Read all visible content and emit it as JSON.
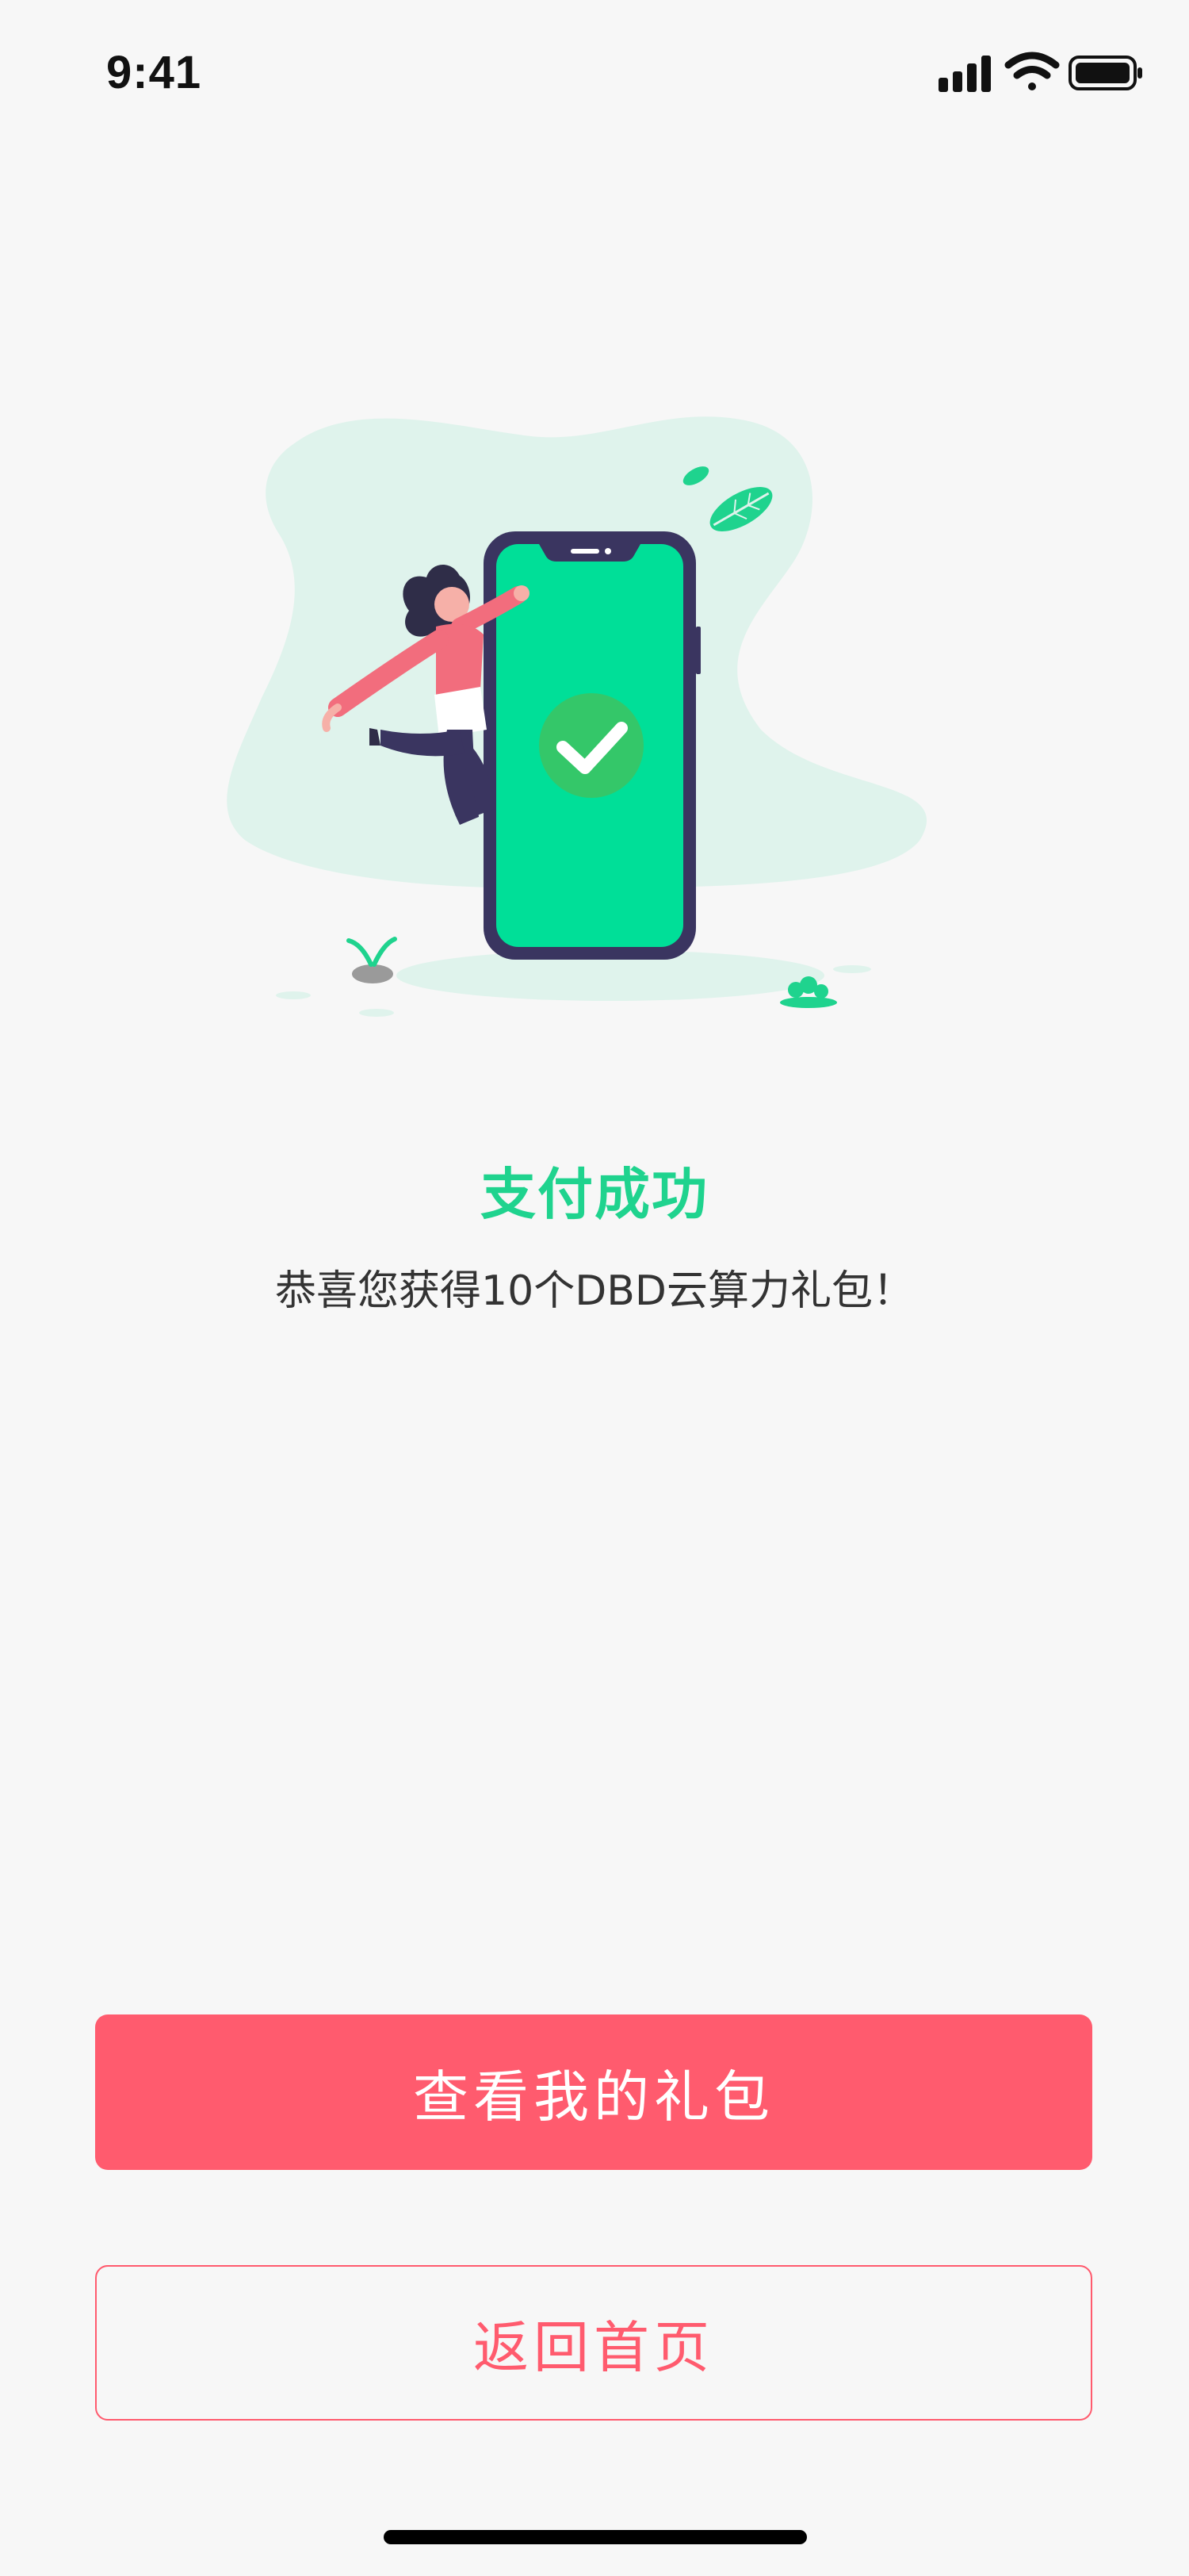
{
  "status_bar": {
    "time": "9:41",
    "icons": [
      "signal-icon",
      "wifi-icon",
      "battery-icon"
    ]
  },
  "illustration": {
    "name": "payment-success-illustration",
    "icons": [
      "phone-icon",
      "check-icon",
      "person-figure",
      "leaf-icon",
      "plant-icon"
    ]
  },
  "result": {
    "title": "支付成功",
    "message": "恭喜您获得10个DBD云算力礼包！"
  },
  "actions": {
    "primary_label": "查看我的礼包",
    "secondary_label": "返回首页"
  },
  "colors": {
    "accent_green": "#1fd38e",
    "accent_red": "#ff5b6e",
    "background": "#f7f7f7"
  }
}
